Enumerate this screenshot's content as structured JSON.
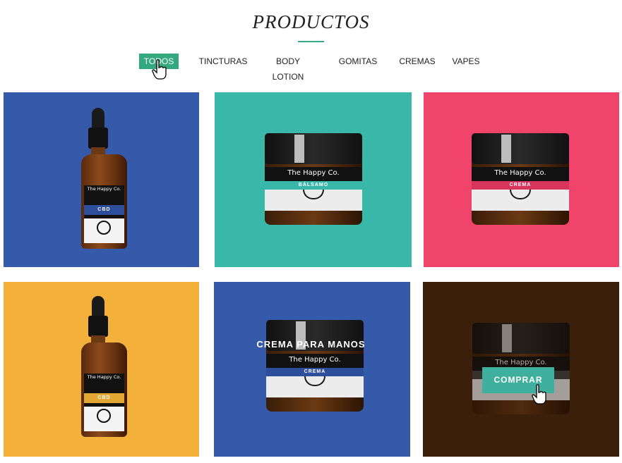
{
  "header": {
    "title": "PRODUCTOS"
  },
  "filters": [
    {
      "label": "TODOS",
      "active": true
    },
    {
      "label": "TINCTURAS"
    },
    {
      "label": "BODY LOTION"
    },
    {
      "label": "GOMITAS"
    },
    {
      "label": "CREMAS"
    },
    {
      "label": "VAPES"
    }
  ],
  "colors": {
    "accent": "#34a87e",
    "tile_blue": "#355aa9",
    "tile_teal": "#39b7a8",
    "tile_pink": "#f1446b",
    "tile_yellow": "#f3b03a",
    "tile_brown": "#4a2910"
  },
  "products": [
    {
      "type": "bottle",
      "brand": "The Happy Co.",
      "band_text": "CBD",
      "band_color": "#2c4e9b"
    },
    {
      "type": "jar",
      "brand": "The Happy Co.",
      "band_text": "BÁLSAMO",
      "band_color": "#39b7a8"
    },
    {
      "type": "jar",
      "brand": "The Happy Co.",
      "band_text": "CREMA",
      "band_color": "#d8355c"
    },
    {
      "type": "bottle",
      "brand": "The Happy Co.",
      "band_text": "CBD",
      "band_color": "#e3a833"
    },
    {
      "type": "jar",
      "brand": "The Happy Co.",
      "band_text": "CREMA",
      "band_color": "#2c4e9b"
    },
    {
      "type": "jar",
      "brand": "The Happy Co.",
      "hover_title": "CREMA PARA MANOS",
      "button_label": "COMPRAR"
    }
  ]
}
